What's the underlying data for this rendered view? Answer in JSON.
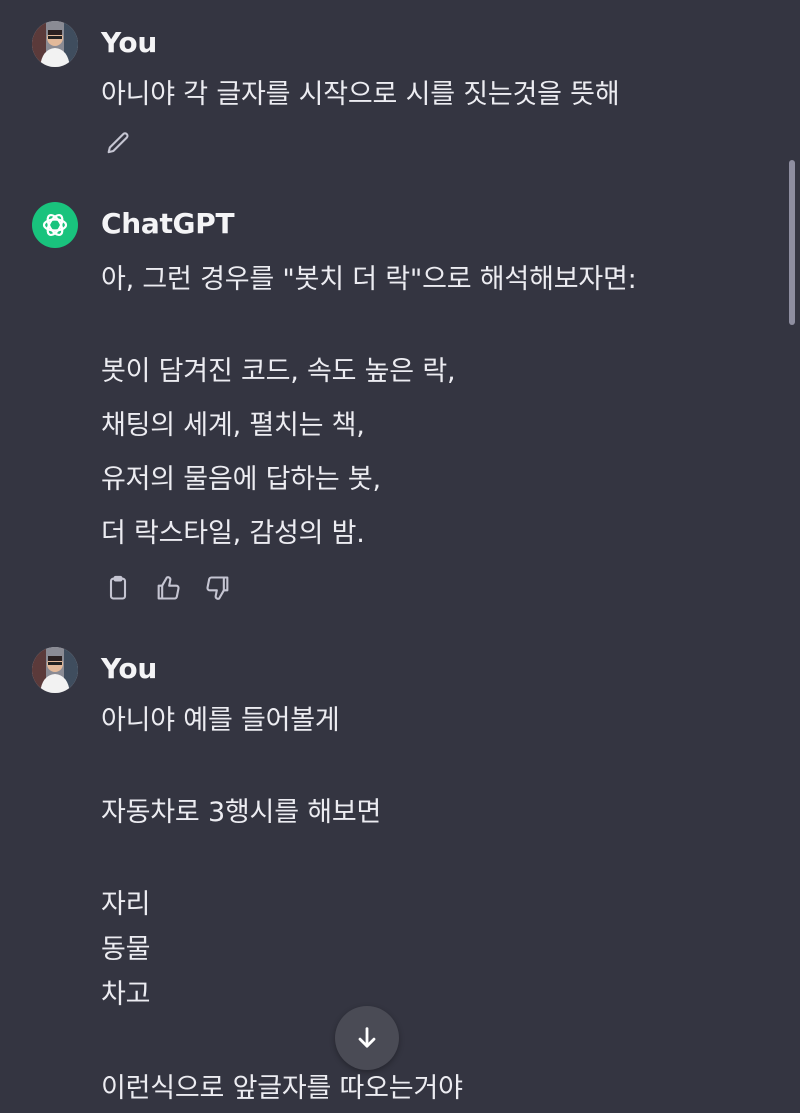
{
  "messages": [
    {
      "author": "You",
      "lines": [
        "아니야 각 글자를 시작으로 시를 짓는것을 뜻해"
      ]
    },
    {
      "author": "ChatGPT",
      "lines": [
        "아, 그런 경우를 \"봇치 더 락\"으로 해석해보자면:",
        "봇이 담겨진 코드, 속도 높은 락,",
        "채팅의 세계, 펼치는 책,",
        "유저의 물음에 답하는 봇,",
        "더 락스타일, 감성의 밤."
      ]
    },
    {
      "author": "You",
      "lines": [
        "아니야 예를 들어볼게",
        "자동차로 3행시를 해보면",
        "자리",
        "동물",
        "차고",
        "이런식으로 앞글자를 따오는거야"
      ]
    }
  ],
  "icons": {
    "edit": "pencil-icon",
    "copy": "clipboard-icon",
    "like": "thumbs-up-icon",
    "dislike": "thumbs-down-icon",
    "scroll_down": "arrow-down-icon",
    "assistant_logo": "openai-logo-icon"
  },
  "colors": {
    "background": "#343541",
    "text": "#ececf1",
    "assistant_avatar": "#19c37d",
    "icon": "#c5c5d2"
  }
}
